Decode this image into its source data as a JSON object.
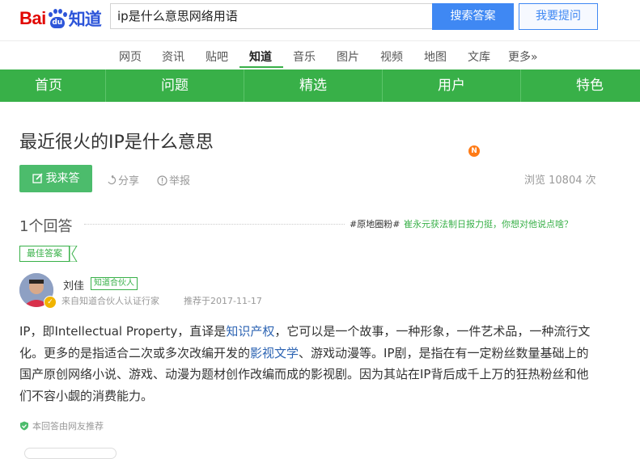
{
  "header": {
    "logo": {
      "bai": "Bai",
      "du": "du",
      "zhidao": "知道"
    },
    "search_value": "ip是什么意思网络用语",
    "search_button": "搜索答案",
    "ask_button": "我要提问"
  },
  "topnav": {
    "items": [
      "网页",
      "资讯",
      "贴吧",
      "知道",
      "音乐",
      "图片",
      "视频",
      "地图",
      "文库",
      "更多»"
    ],
    "active": "知道"
  },
  "greenbar": {
    "items": [
      "首页",
      "问题",
      "精选",
      "用户",
      "特色"
    ],
    "user_badge": "N"
  },
  "question": {
    "title": "最近很火的IP是什么意思",
    "answer_button": "我来答",
    "share": "分享",
    "report": "举报",
    "views": "浏览 10804 次"
  },
  "answers": {
    "count": "1个回答",
    "topic_tag": "#原地圈粉#",
    "topic_link": "崔永元获法制日报力挺，你想对他说点啥？",
    "best_tag": "最佳答案"
  },
  "answer": {
    "author": "刘佳",
    "partner_tag": "知道合伙人",
    "source": "来自知道合伙人认证行家",
    "date": "推荐于2017-11-17",
    "content": {
      "p1": "IP，即Intellectual Property，直译是",
      "link1": "知识产权",
      "p2": "，它可以是一个故事，一种形象，一件艺术品，一种流行文化。更多的是指适合二次或多次改编开发的",
      "link2": "影视文学",
      "p3": "、游戏动漫等。IP剧，是指在有一定粉丝数量基础上的国产原创网络小说、游戏、动漫为题材创作改编而成的影视剧。因为其站在IP背后成千上万的狂热粉丝和他们不容小觑的消费能力。"
    },
    "recommend": "本回答由网友推荐"
  },
  "colors": {
    "green": "#38b048",
    "blue": "#3f88f3",
    "link": "#2d64b3",
    "orange": "#ff7b16"
  }
}
